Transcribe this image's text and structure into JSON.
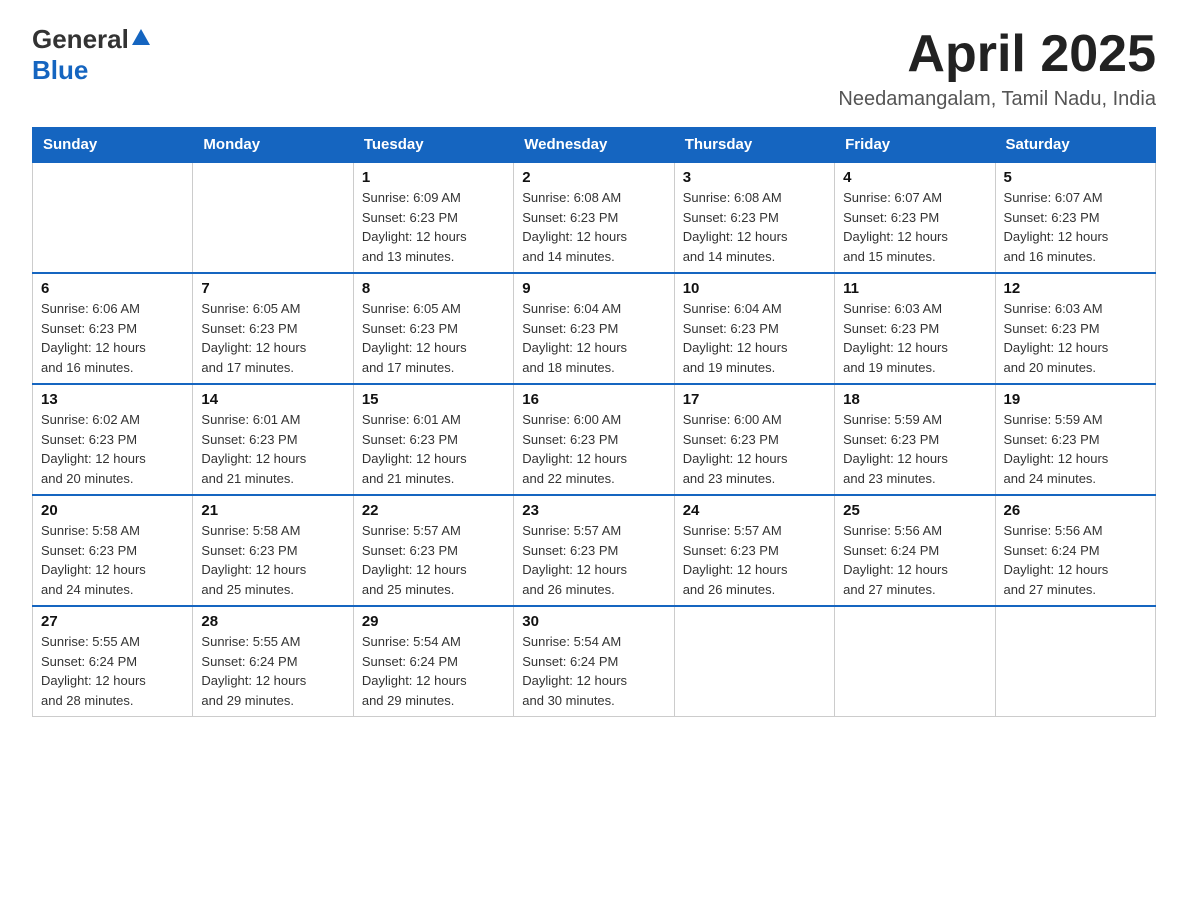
{
  "logo": {
    "general": "General",
    "blue": "Blue",
    "triangle": "▲"
  },
  "title": "April 2025",
  "subtitle": "Needamangalam, Tamil Nadu, India",
  "headers": [
    "Sunday",
    "Monday",
    "Tuesday",
    "Wednesday",
    "Thursday",
    "Friday",
    "Saturday"
  ],
  "weeks": [
    [
      {
        "day": "",
        "info": ""
      },
      {
        "day": "",
        "info": ""
      },
      {
        "day": "1",
        "info": "Sunrise: 6:09 AM\nSunset: 6:23 PM\nDaylight: 12 hours\nand 13 minutes."
      },
      {
        "day": "2",
        "info": "Sunrise: 6:08 AM\nSunset: 6:23 PM\nDaylight: 12 hours\nand 14 minutes."
      },
      {
        "day": "3",
        "info": "Sunrise: 6:08 AM\nSunset: 6:23 PM\nDaylight: 12 hours\nand 14 minutes."
      },
      {
        "day": "4",
        "info": "Sunrise: 6:07 AM\nSunset: 6:23 PM\nDaylight: 12 hours\nand 15 minutes."
      },
      {
        "day": "5",
        "info": "Sunrise: 6:07 AM\nSunset: 6:23 PM\nDaylight: 12 hours\nand 16 minutes."
      }
    ],
    [
      {
        "day": "6",
        "info": "Sunrise: 6:06 AM\nSunset: 6:23 PM\nDaylight: 12 hours\nand 16 minutes."
      },
      {
        "day": "7",
        "info": "Sunrise: 6:05 AM\nSunset: 6:23 PM\nDaylight: 12 hours\nand 17 minutes."
      },
      {
        "day": "8",
        "info": "Sunrise: 6:05 AM\nSunset: 6:23 PM\nDaylight: 12 hours\nand 17 minutes."
      },
      {
        "day": "9",
        "info": "Sunrise: 6:04 AM\nSunset: 6:23 PM\nDaylight: 12 hours\nand 18 minutes."
      },
      {
        "day": "10",
        "info": "Sunrise: 6:04 AM\nSunset: 6:23 PM\nDaylight: 12 hours\nand 19 minutes."
      },
      {
        "day": "11",
        "info": "Sunrise: 6:03 AM\nSunset: 6:23 PM\nDaylight: 12 hours\nand 19 minutes."
      },
      {
        "day": "12",
        "info": "Sunrise: 6:03 AM\nSunset: 6:23 PM\nDaylight: 12 hours\nand 20 minutes."
      }
    ],
    [
      {
        "day": "13",
        "info": "Sunrise: 6:02 AM\nSunset: 6:23 PM\nDaylight: 12 hours\nand 20 minutes."
      },
      {
        "day": "14",
        "info": "Sunrise: 6:01 AM\nSunset: 6:23 PM\nDaylight: 12 hours\nand 21 minutes."
      },
      {
        "day": "15",
        "info": "Sunrise: 6:01 AM\nSunset: 6:23 PM\nDaylight: 12 hours\nand 21 minutes."
      },
      {
        "day": "16",
        "info": "Sunrise: 6:00 AM\nSunset: 6:23 PM\nDaylight: 12 hours\nand 22 minutes."
      },
      {
        "day": "17",
        "info": "Sunrise: 6:00 AM\nSunset: 6:23 PM\nDaylight: 12 hours\nand 23 minutes."
      },
      {
        "day": "18",
        "info": "Sunrise: 5:59 AM\nSunset: 6:23 PM\nDaylight: 12 hours\nand 23 minutes."
      },
      {
        "day": "19",
        "info": "Sunrise: 5:59 AM\nSunset: 6:23 PM\nDaylight: 12 hours\nand 24 minutes."
      }
    ],
    [
      {
        "day": "20",
        "info": "Sunrise: 5:58 AM\nSunset: 6:23 PM\nDaylight: 12 hours\nand 24 minutes."
      },
      {
        "day": "21",
        "info": "Sunrise: 5:58 AM\nSunset: 6:23 PM\nDaylight: 12 hours\nand 25 minutes."
      },
      {
        "day": "22",
        "info": "Sunrise: 5:57 AM\nSunset: 6:23 PM\nDaylight: 12 hours\nand 25 minutes."
      },
      {
        "day": "23",
        "info": "Sunrise: 5:57 AM\nSunset: 6:23 PM\nDaylight: 12 hours\nand 26 minutes."
      },
      {
        "day": "24",
        "info": "Sunrise: 5:57 AM\nSunset: 6:23 PM\nDaylight: 12 hours\nand 26 minutes."
      },
      {
        "day": "25",
        "info": "Sunrise: 5:56 AM\nSunset: 6:24 PM\nDaylight: 12 hours\nand 27 minutes."
      },
      {
        "day": "26",
        "info": "Sunrise: 5:56 AM\nSunset: 6:24 PM\nDaylight: 12 hours\nand 27 minutes."
      }
    ],
    [
      {
        "day": "27",
        "info": "Sunrise: 5:55 AM\nSunset: 6:24 PM\nDaylight: 12 hours\nand 28 minutes."
      },
      {
        "day": "28",
        "info": "Sunrise: 5:55 AM\nSunset: 6:24 PM\nDaylight: 12 hours\nand 29 minutes."
      },
      {
        "day": "29",
        "info": "Sunrise: 5:54 AM\nSunset: 6:24 PM\nDaylight: 12 hours\nand 29 minutes."
      },
      {
        "day": "30",
        "info": "Sunrise: 5:54 AM\nSunset: 6:24 PM\nDaylight: 12 hours\nand 30 minutes."
      },
      {
        "day": "",
        "info": ""
      },
      {
        "day": "",
        "info": ""
      },
      {
        "day": "",
        "info": ""
      }
    ]
  ]
}
